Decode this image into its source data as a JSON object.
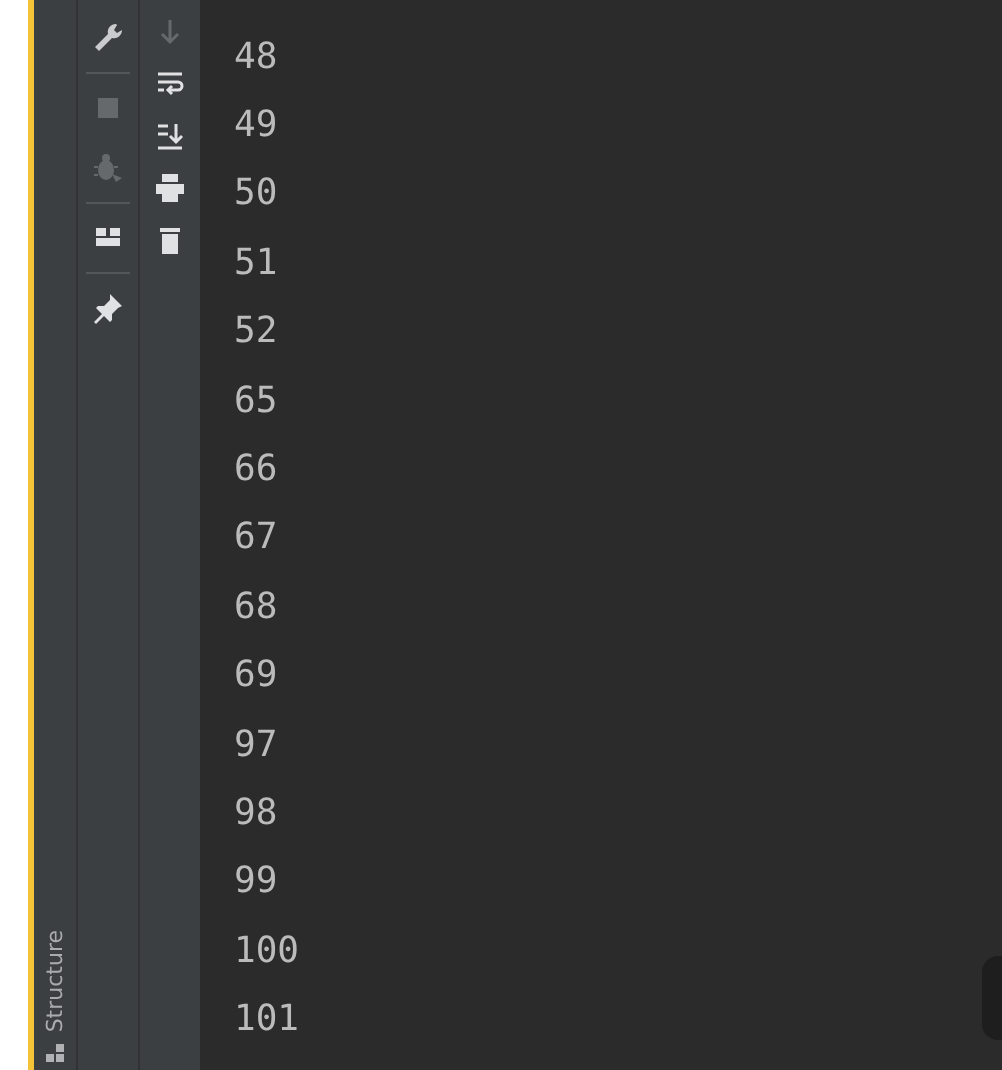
{
  "side_tab": {
    "label": "Structure"
  },
  "left_toolbar": [
    {
      "kind": "wrench",
      "disabled": false
    },
    {
      "kind": "divider"
    },
    {
      "kind": "stop",
      "disabled": true
    },
    {
      "kind": "bug",
      "disabled": true
    },
    {
      "kind": "divider"
    },
    {
      "kind": "layout",
      "disabled": false
    },
    {
      "kind": "divider"
    },
    {
      "kind": "pin",
      "disabled": false
    }
  ],
  "right_toolbar": [
    {
      "kind": "down",
      "disabled": true
    },
    {
      "kind": "wrap",
      "disabled": false
    },
    {
      "kind": "scroll-end",
      "disabled": false
    },
    {
      "kind": "print",
      "disabled": false
    },
    {
      "kind": "trash",
      "disabled": false
    }
  ],
  "console": {
    "lines": [
      "48",
      "49",
      "50",
      "51",
      "52",
      "65",
      "66",
      "67",
      "68",
      "69",
      "97",
      "98",
      "99",
      "100",
      "101"
    ]
  }
}
